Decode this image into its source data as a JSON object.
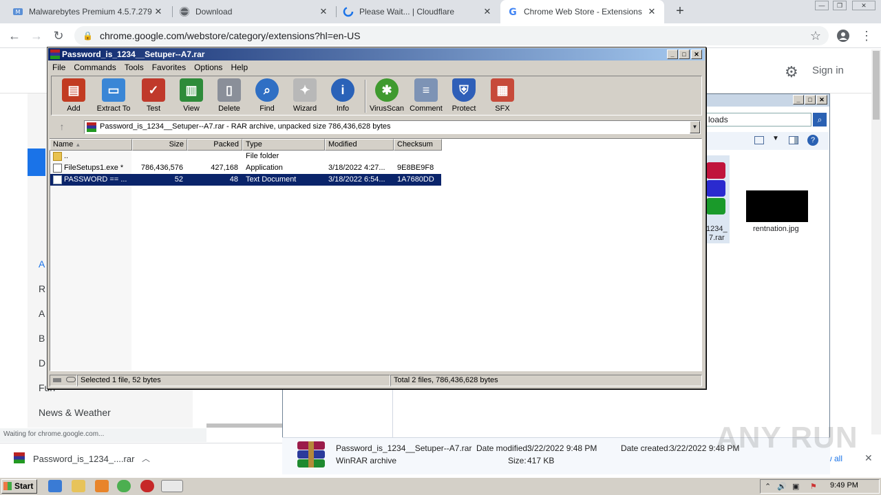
{
  "browser": {
    "tabs": [
      {
        "label": "Malwarebytes Premium 4.5.7.279 Cr",
        "active": false
      },
      {
        "label": "Download",
        "active": false
      },
      {
        "label": "Please Wait... | Cloudflare",
        "active": false
      },
      {
        "label": "Chrome Web Store - Extensions",
        "active": true
      }
    ],
    "new_tab": "+",
    "url": "chrome.google.com/webstore/category/extensions?hl=en-US",
    "status_text": "Waiting for chrome.google.com...",
    "download_item": "Password_is_1234_....rar"
  },
  "webstore": {
    "sign_in": "Sign in",
    "categories": [
      "A",
      "R",
      "A",
      "B",
      "D",
      "Fun",
      "News & Weather"
    ],
    "show_all": "w all"
  },
  "explorer": {
    "address_partial": "loads",
    "rar_label_1": "1234_",
    "rar_label_2": "7.rar",
    "image_name": "rentnation.jpg",
    "details": {
      "name": "Password_is_1234__Setuper--A7.rar",
      "type": "WinRAR archive",
      "date_modified_label": "Date modified:",
      "date_modified": "3/22/2022 9:48 PM",
      "date_created_label": "Date created:",
      "date_created": "3/22/2022 9:48 PM",
      "size_label": "Size:",
      "size": "417 KB"
    }
  },
  "winrar": {
    "title": "Password_is_1234__Setuper--A7.rar",
    "menu": [
      "File",
      "Commands",
      "Tools",
      "Favorites",
      "Options",
      "Help"
    ],
    "tools": [
      {
        "label": "Add",
        "icon": "add-icon",
        "color": "#c23b22"
      },
      {
        "label": "Extract To",
        "icon": "extract-folder-icon",
        "color": "#3a86d6"
      },
      {
        "label": "Test",
        "icon": "test-clipboard-icon",
        "color": "#c0392b"
      },
      {
        "label": "View",
        "icon": "view-book-icon",
        "color": "#2e8b3a"
      },
      {
        "label": "Delete",
        "icon": "trash-icon",
        "color": "#8a8f99"
      },
      {
        "label": "Find",
        "icon": "magnifier-icon",
        "color": "#2f6fc4"
      },
      {
        "label": "Wizard",
        "icon": "wand-icon",
        "color": "#b8b8b8"
      },
      {
        "label": "Info",
        "icon": "info-icon",
        "color": "#2a62b8"
      },
      {
        "label": "VirusScan",
        "icon": "bug-icon",
        "color": "#3f9a2f"
      },
      {
        "label": "Comment",
        "icon": "comment-icon",
        "color": "#7d93b5"
      },
      {
        "label": "Protect",
        "icon": "shield-icon",
        "color": "#2f5fb8"
      },
      {
        "label": "SFX",
        "icon": "sfx-books-icon",
        "color": "#c74a3a"
      }
    ],
    "path": "Password_is_1234__Setuper--A7.rar - RAR archive, unpacked size 786,436,628 bytes",
    "columns": {
      "name": "Name",
      "size": "Size",
      "packed": "Packed",
      "type": "Type",
      "modified": "Modified",
      "checksum": "Checksum"
    },
    "files": [
      {
        "name": "..",
        "size": "",
        "packed": "",
        "type": "File folder",
        "modified": "",
        "checksum": "",
        "selected": false
      },
      {
        "name": "FileSetups1.exe *",
        "size": "786,436,576",
        "packed": "427,168",
        "type": "Application",
        "modified": "3/18/2022 4:27...",
        "checksum": "9E8BE9F8",
        "selected": false
      },
      {
        "name": "PASSWORD == ...",
        "size": "52",
        "packed": "48",
        "type": "Text Document",
        "modified": "3/18/2022 6:54...",
        "checksum": "1A7680DD",
        "selected": true
      }
    ],
    "status_left": "Selected 1 file, 52 bytes",
    "status_right": "Total 2 files, 786,436,628 bytes"
  },
  "taskbar": {
    "start": "Start",
    "clock": "9:49 PM"
  },
  "watermark": "ANY RUN"
}
